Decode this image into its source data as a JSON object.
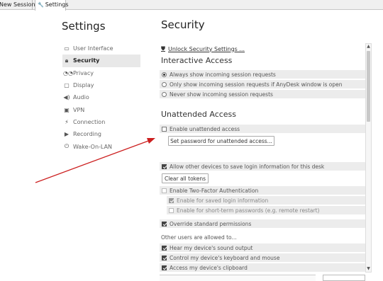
{
  "tabs": [
    {
      "label": "New Session"
    },
    {
      "label": "Settings",
      "icon": "wrench-icon"
    }
  ],
  "sidebar": {
    "title": "Settings",
    "items": [
      {
        "label": "User Interface",
        "icon": "ui-icon"
      },
      {
        "label": "Security",
        "icon": "lock-icon",
        "active": true
      },
      {
        "label": "Privacy",
        "icon": "privacy-icon"
      },
      {
        "label": "Display",
        "icon": "display-icon"
      },
      {
        "label": "Audio",
        "icon": "speaker-icon"
      },
      {
        "label": "VPN",
        "icon": "vpn-icon"
      },
      {
        "label": "Connection",
        "icon": "connection-icon"
      },
      {
        "label": "Recording",
        "icon": "record-icon"
      },
      {
        "label": "Wake-On-LAN",
        "icon": "power-icon"
      }
    ]
  },
  "main": {
    "title": "Security",
    "unlock_label": "Unlock Security Settings ...",
    "interactive": {
      "title": "Interactive Access",
      "options": [
        {
          "label": "Always show incoming session requests",
          "selected": true
        },
        {
          "label": "Only show incoming session requests if AnyDesk window is open",
          "selected": false
        },
        {
          "label": "Never show incoming session requests",
          "selected": false
        }
      ]
    },
    "unattended": {
      "title": "Unattended Access",
      "enable_label": "Enable unattended access",
      "enable_checked": false,
      "set_password_button": "Set password for unattended access...",
      "allow_devices_label": "Allow other devices to save login information for this desk",
      "allow_devices_checked": true,
      "clear_tokens_button": "Clear all tokens",
      "two_factor_label": "Enable Two-Factor Authentication",
      "two_factor_checked": false,
      "saved_login_label": "Enable for saved login information",
      "saved_login_checked": true,
      "short_term_label": "Enable for short-term passwords (e.g. remote restart)",
      "short_term_checked": false,
      "override_label": "Override standard permissions",
      "override_checked": true
    },
    "permissions": {
      "heading": "Other users are allowed to...",
      "items": [
        {
          "label": "Hear my device's sound output",
          "checked": true
        },
        {
          "label": "Control my device's keyboard and mouse",
          "checked": true
        },
        {
          "label": "Access my device's clipboard",
          "checked": true
        }
      ]
    }
  },
  "colors": {
    "annotation_arrow": "#cc1f1f",
    "row_background": "#ececec",
    "active_sidebar": "#e8e8e8"
  }
}
